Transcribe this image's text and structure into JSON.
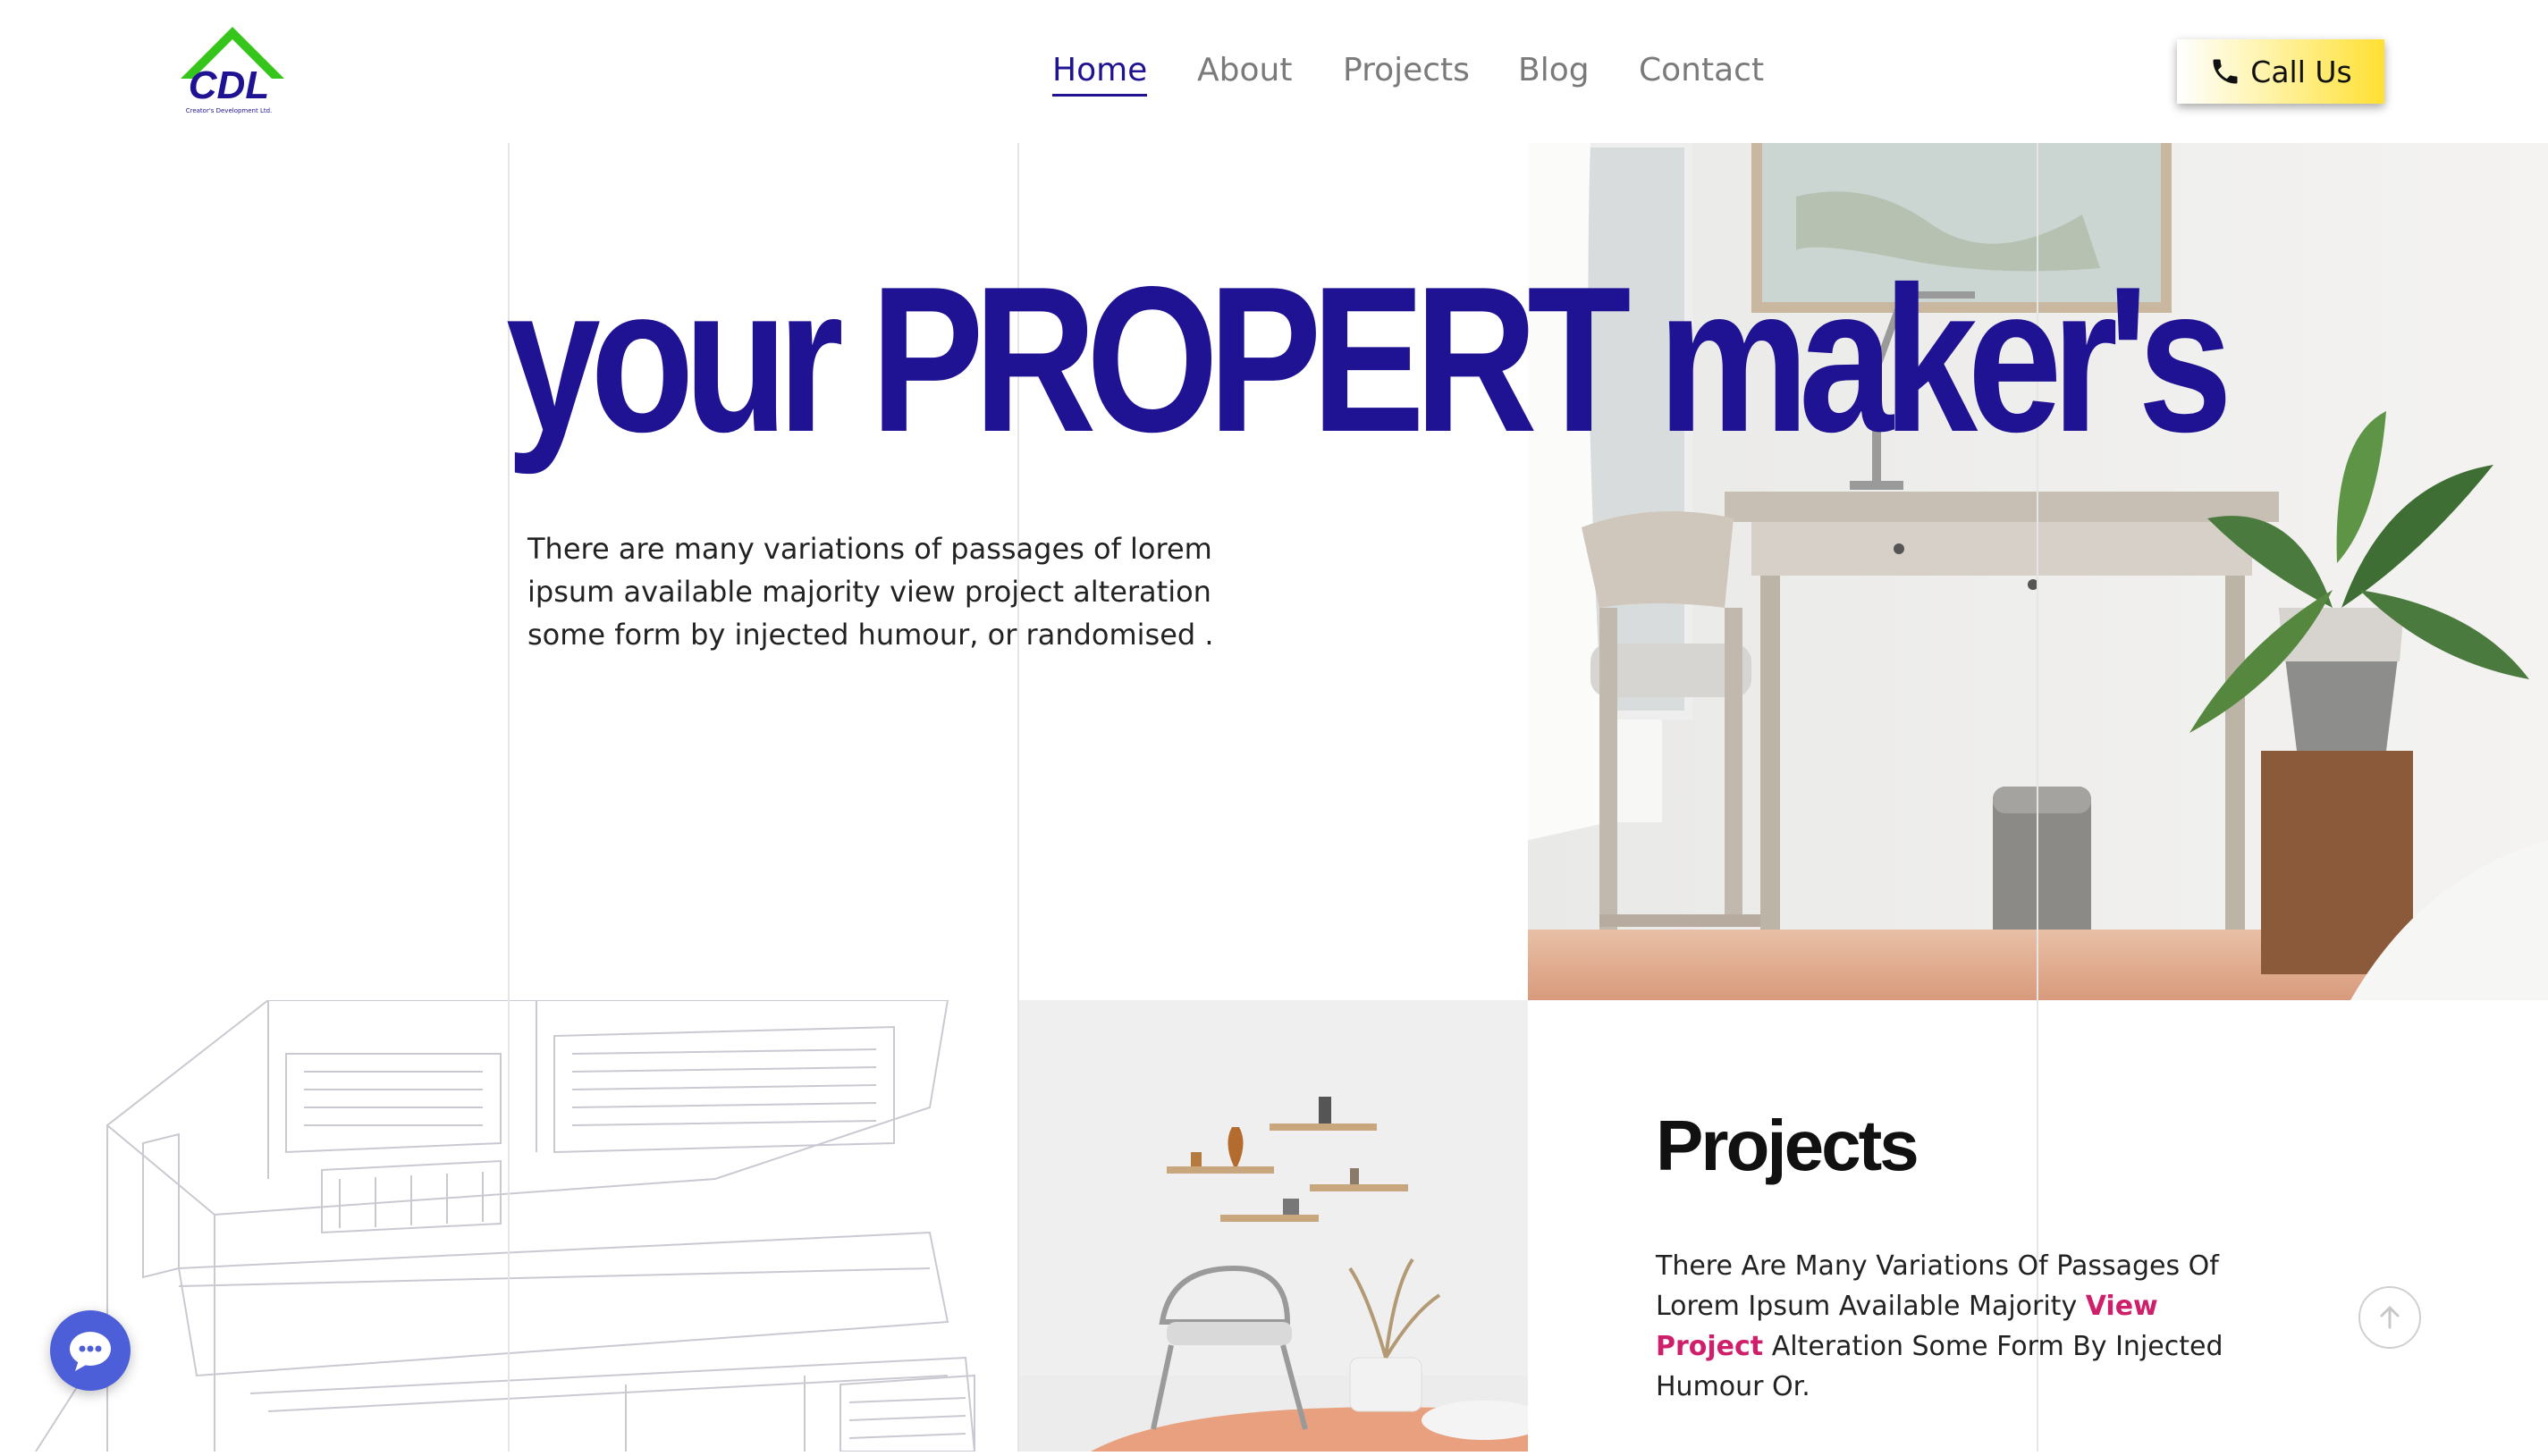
{
  "brand": {
    "logo_text": "CDL",
    "logo_tagline": "Creator's Development Ltd."
  },
  "nav": {
    "items": [
      {
        "label": "Home",
        "active": true
      },
      {
        "label": "About",
        "active": false
      },
      {
        "label": "Projects",
        "active": false
      },
      {
        "label": "Blog",
        "active": false
      },
      {
        "label": "Contact",
        "active": false
      }
    ],
    "call_button": {
      "label": "Call Us",
      "icon": "phone-icon"
    }
  },
  "hero": {
    "title": "your PROPERT maker's",
    "text": "There are many variations of passages of lorem ipsum available majority view project alteration some form by injected humour, or randomised ."
  },
  "projects": {
    "title": "Projects",
    "text_before": "There Are Many Variations Of Passages Of Lorem Ipsum Available Majority ",
    "link_label": "View Project",
    "text_after": " Alteration Some Form By Injected Humour Or."
  },
  "floating": {
    "chat_icon": "chat-bubble-icon",
    "scroll_icon": "arrow-up-icon"
  },
  "colors": {
    "primary": "#1f1393",
    "accent": "#d01f6a",
    "call_button_yellow": "#ffe033",
    "logo_green": "#35c51b",
    "chat_blue": "#4d5fd8"
  }
}
